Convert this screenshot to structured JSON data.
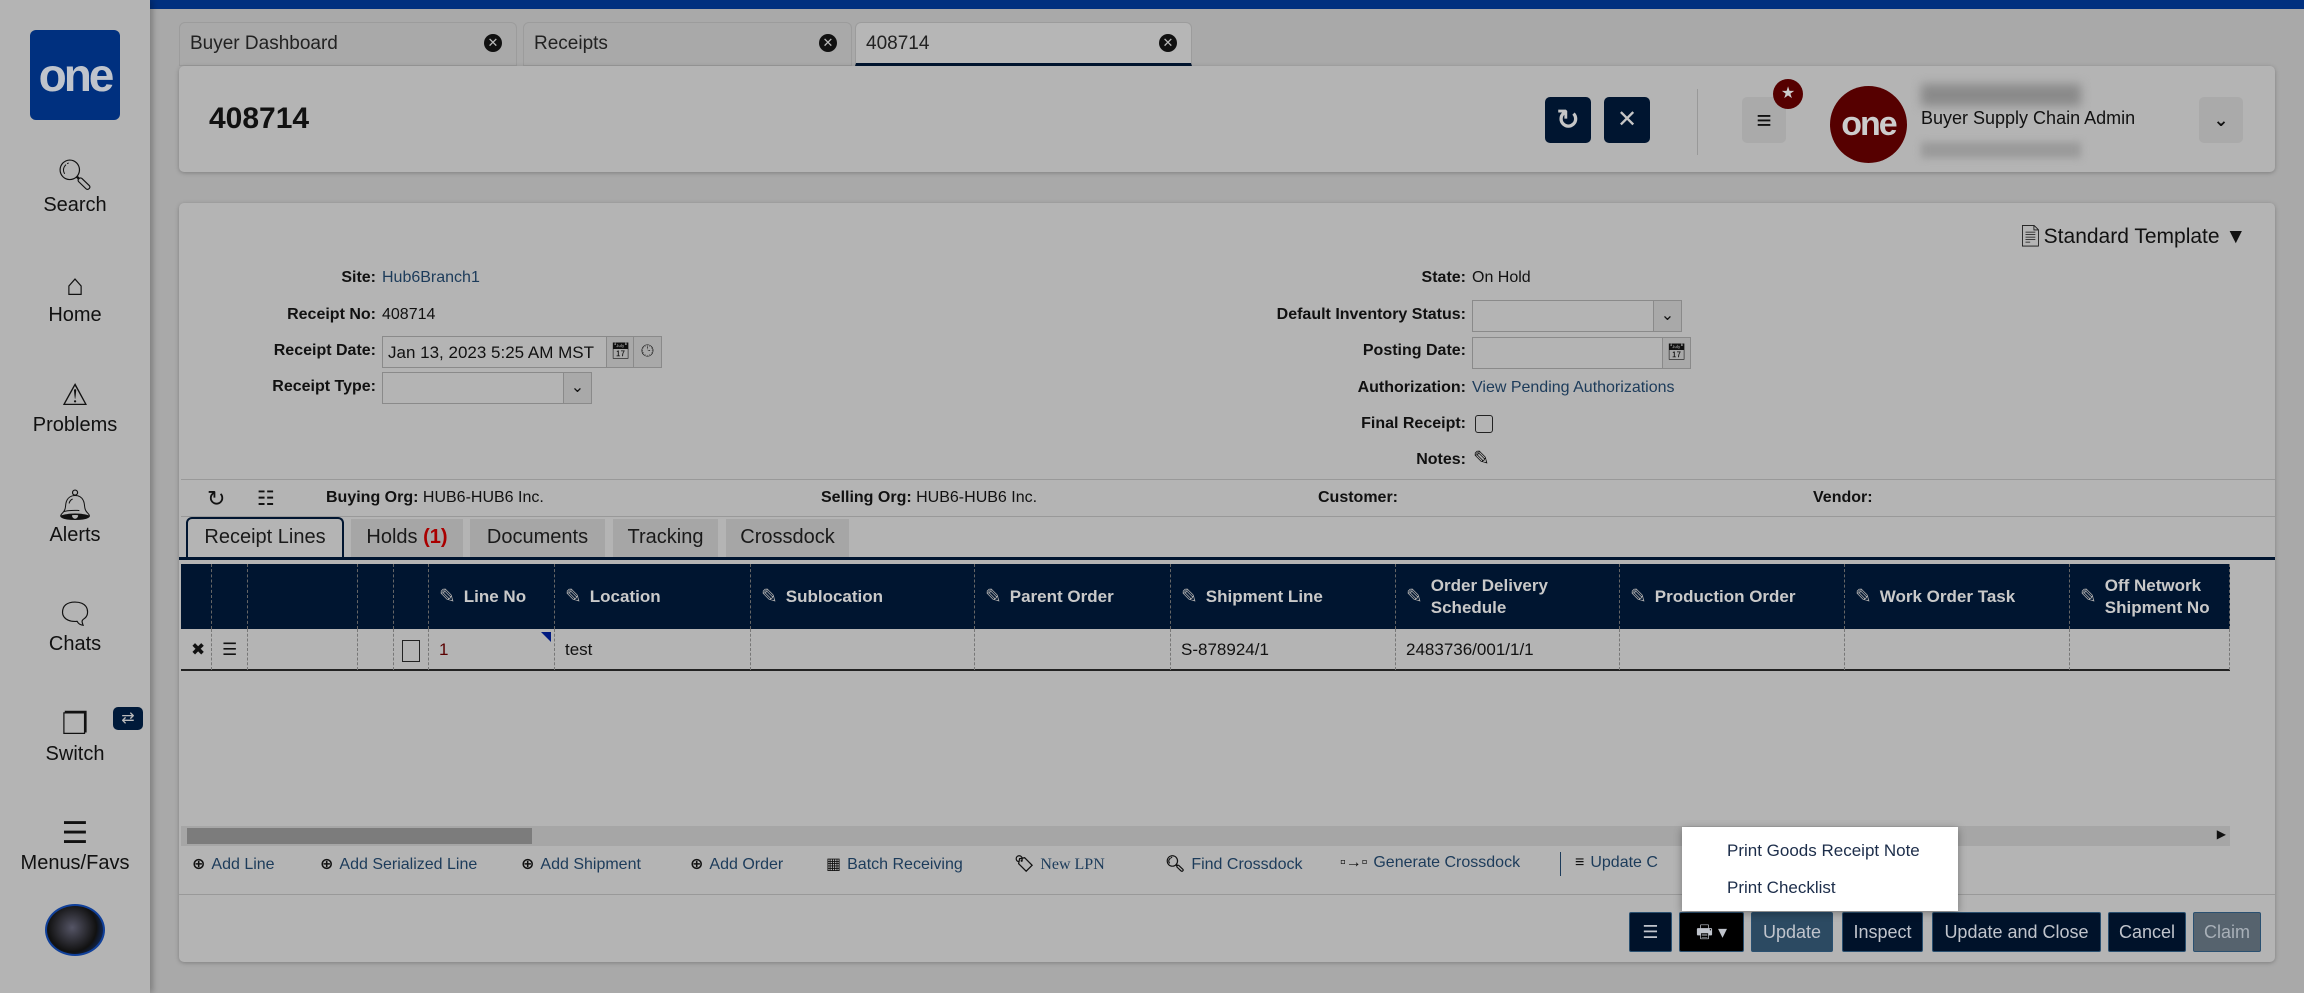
{
  "sidebar": {
    "logo": "one",
    "items": [
      {
        "label": "Search",
        "icon": "search-icon"
      },
      {
        "label": "Home",
        "icon": "home-icon"
      },
      {
        "label": "Problems",
        "icon": "warning-icon"
      },
      {
        "label": "Alerts",
        "icon": "bell-icon"
      },
      {
        "label": "Chats",
        "icon": "chat-icon"
      },
      {
        "label": "Switch",
        "icon": "switch-icon"
      },
      {
        "label": "Menus/Favs",
        "icon": "menu-icon"
      }
    ]
  },
  "tabs": [
    {
      "label": "Buyer Dashboard"
    },
    {
      "label": "Receipts"
    },
    {
      "label": "408714"
    }
  ],
  "header": {
    "title": "408714",
    "user_role": "Buyer Supply Chain Admin",
    "avatar_text": "one"
  },
  "template": {
    "label": "Standard Template"
  },
  "form": {
    "site_label": "Site:",
    "site": "Hub6Branch1",
    "receipt_no_label": "Receipt No:",
    "receipt_no": "408714",
    "receipt_date_label": "Receipt Date:",
    "receipt_date": "Jan 13, 2023 5:25 AM MST",
    "receipt_type_label": "Receipt Type:",
    "receipt_type": "",
    "state_label": "State:",
    "state": "On Hold",
    "inv_status_label": "Default Inventory Status:",
    "inv_status": "",
    "posting_date_label": "Posting Date:",
    "posting_date": "",
    "authorization_label": "Authorization:",
    "authorization": "View Pending Authorizations",
    "final_receipt_label": "Final Receipt:",
    "notes_label": "Notes:"
  },
  "orgs": {
    "buying_label": "Buying Org:",
    "buying": "HUB6-HUB6 Inc.",
    "selling_label": "Selling Org:",
    "selling": "HUB6-HUB6 Inc.",
    "customer_label": "Customer:",
    "vendor_label": "Vendor:"
  },
  "panel_tabs": [
    {
      "label": "Receipt Lines"
    },
    {
      "label": "Holds ",
      "count": "(1)"
    },
    {
      "label": "Documents"
    },
    {
      "label": "Tracking"
    },
    {
      "label": "Crossdock"
    }
  ],
  "table": {
    "columns": [
      "Line No",
      "Location",
      "Sublocation",
      "Parent Order",
      "Shipment Line",
      "Order Delivery Schedule",
      "Production Order",
      "Work Order Task",
      "Off Network Shipment No"
    ],
    "rows": [
      {
        "line_no": "1",
        "location": "test",
        "sublocation": "",
        "parent_order": "",
        "shipment_line": "S-878924/1",
        "ods": "2483736/001/1/1",
        "production_order": "",
        "work_order_task": "",
        "off_network": ""
      }
    ]
  },
  "actions": [
    "Add Line",
    "Add Serialized Line",
    "Add Shipment",
    "Add Order",
    "Batch Receiving",
    "New LPN",
    "Find Crossdock",
    "Generate Crossdock",
    "Update C"
  ],
  "buttons": {
    "update": "Update",
    "inspect": "Inspect",
    "update_close": "Update and Close",
    "cancel": "Cancel",
    "claim": "Claim"
  },
  "print_menu": [
    "Print Goods Receipt Note",
    "Print Checklist"
  ]
}
